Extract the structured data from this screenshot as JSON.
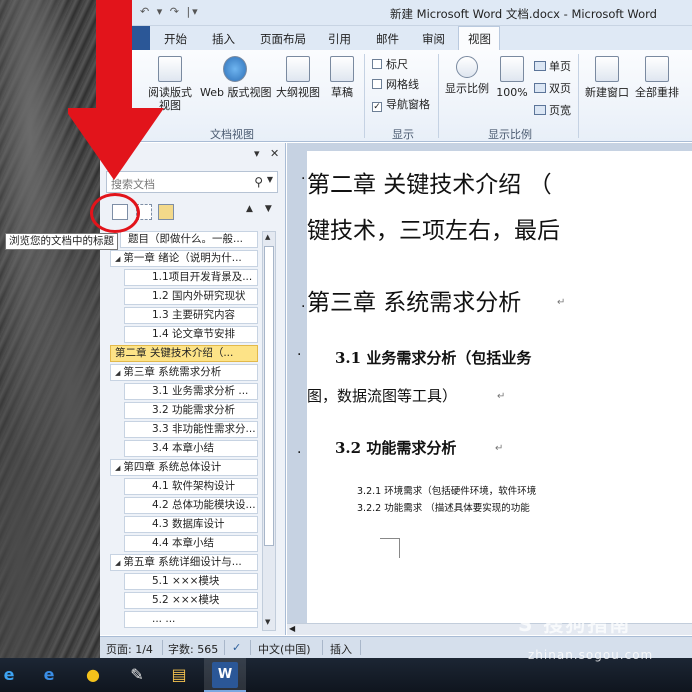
{
  "window": {
    "title": "新建 Microsoft Word 文档.docx - Microsoft Word",
    "qat": "↶ ▾ ↷ |▾"
  },
  "tabs": [
    "开始",
    "插入",
    "页面布局",
    "引用",
    "邮件",
    "审阅",
    "视图"
  ],
  "active_tab": "视图",
  "ribbon": {
    "doc_views": {
      "buttons": [
        "阅读版式\n视图",
        "Web 版式视图",
        "大纲视图",
        "草稿"
      ],
      "label": "文档视图"
    },
    "show": {
      "checkboxes": [
        {
          "label": "标尺",
          "checked": false
        },
        {
          "label": "网格线",
          "checked": false
        },
        {
          "label": "导航窗格",
          "checked": true
        }
      ],
      "label": "显示"
    },
    "zoom": {
      "buttons": [
        "显示比例",
        "100%"
      ],
      "small": [
        "单页",
        "双页",
        "页宽"
      ],
      "label": "显示比例"
    },
    "window_group": {
      "buttons": [
        "新建窗口",
        "全部重排"
      ]
    }
  },
  "nav": {
    "search_placeholder": "搜索文档",
    "search_icon": "magnifier-icon",
    "close_glyph": "✕",
    "menu_glyph": "▾",
    "up_glyph": "▲",
    "down_glyph": "▼",
    "tooltip": "浏览您的文档中的标题",
    "outline": [
      {
        "text": "题目（即做什么。一般...",
        "level": 0,
        "expanded": null,
        "selected": false
      },
      {
        "text": "第一章 绪论（说明为什...",
        "level": 1,
        "expanded": true,
        "selected": false
      },
      {
        "text": "1.1项目开发背景及...",
        "level": 2,
        "expanded": null,
        "selected": false
      },
      {
        "text": "1.2 国内外研究现状",
        "level": 2,
        "expanded": null,
        "selected": false
      },
      {
        "text": "1.3 主要研究内容",
        "level": 2,
        "expanded": null,
        "selected": false
      },
      {
        "text": "1.4 论文章节安排",
        "level": 2,
        "expanded": null,
        "selected": false
      },
      {
        "text": "第二章 关键技术介绍（...",
        "level": 1,
        "expanded": null,
        "selected": true
      },
      {
        "text": "第三章 系统需求分析",
        "level": 1,
        "expanded": true,
        "selected": false
      },
      {
        "text": "3.1 业务需求分析 ...",
        "level": 2,
        "expanded": null,
        "selected": false
      },
      {
        "text": "3.2 功能需求分析",
        "level": 2,
        "expanded": null,
        "selected": false
      },
      {
        "text": "3.3 非功能性需求分...",
        "level": 2,
        "expanded": null,
        "selected": false
      },
      {
        "text": "3.4 本章小结",
        "level": 2,
        "expanded": null,
        "selected": false
      },
      {
        "text": "第四章 系统总体设计",
        "level": 1,
        "expanded": true,
        "selected": false
      },
      {
        "text": "4.1 软件架构设计",
        "level": 2,
        "expanded": null,
        "selected": false
      },
      {
        "text": "4.2 总体功能模块设...",
        "level": 2,
        "expanded": null,
        "selected": false
      },
      {
        "text": "4.3 数据库设计",
        "level": 2,
        "expanded": null,
        "selected": false
      },
      {
        "text": "4.4 本章小结",
        "level": 2,
        "expanded": null,
        "selected": false
      },
      {
        "text": "第五章 系统详细设计与...",
        "level": 1,
        "expanded": true,
        "selected": false
      },
      {
        "text": "5.1 ×××模块",
        "level": 2,
        "expanded": null,
        "selected": false
      },
      {
        "text": "5.2 ×××模块",
        "level": 2,
        "expanded": null,
        "selected": false
      },
      {
        "text": "... ...",
        "level": 2,
        "expanded": null,
        "selected": false
      }
    ]
  },
  "document": {
    "line1": "第二章  关键技术介绍  （",
    "line2": "键技术，三项左右，最后",
    "line3": "第三章  系统需求分析",
    "line4": "3.1  业务需求分析（包括业务",
    "line5": "图，数据流图等工具）",
    "line6": "3.2  功能需求分析",
    "line7": "3.2.1 环境需求（包括硬件环境，软件环境",
    "line8": "3.2.2 功能需求 （描述具体要实现的功能",
    "para_mark": "↵"
  },
  "status": {
    "page": "页面: 1/4",
    "words": "字数: 565",
    "lang": "中文(中国)",
    "mode": "插入"
  },
  "taskbar": {
    "items": [
      "start-icon",
      "ie-icon",
      "qq-icon",
      "paint-icon",
      "explorer-icon",
      "word-icon"
    ],
    "word_label": "W"
  },
  "watermark": {
    "logo": "S 搜狗指南",
    "url": "zhinan.sogou.com"
  },
  "colors": {
    "accent": "#2b5797",
    "selection": "#fde387",
    "annotation_red": "#e2141b"
  }
}
